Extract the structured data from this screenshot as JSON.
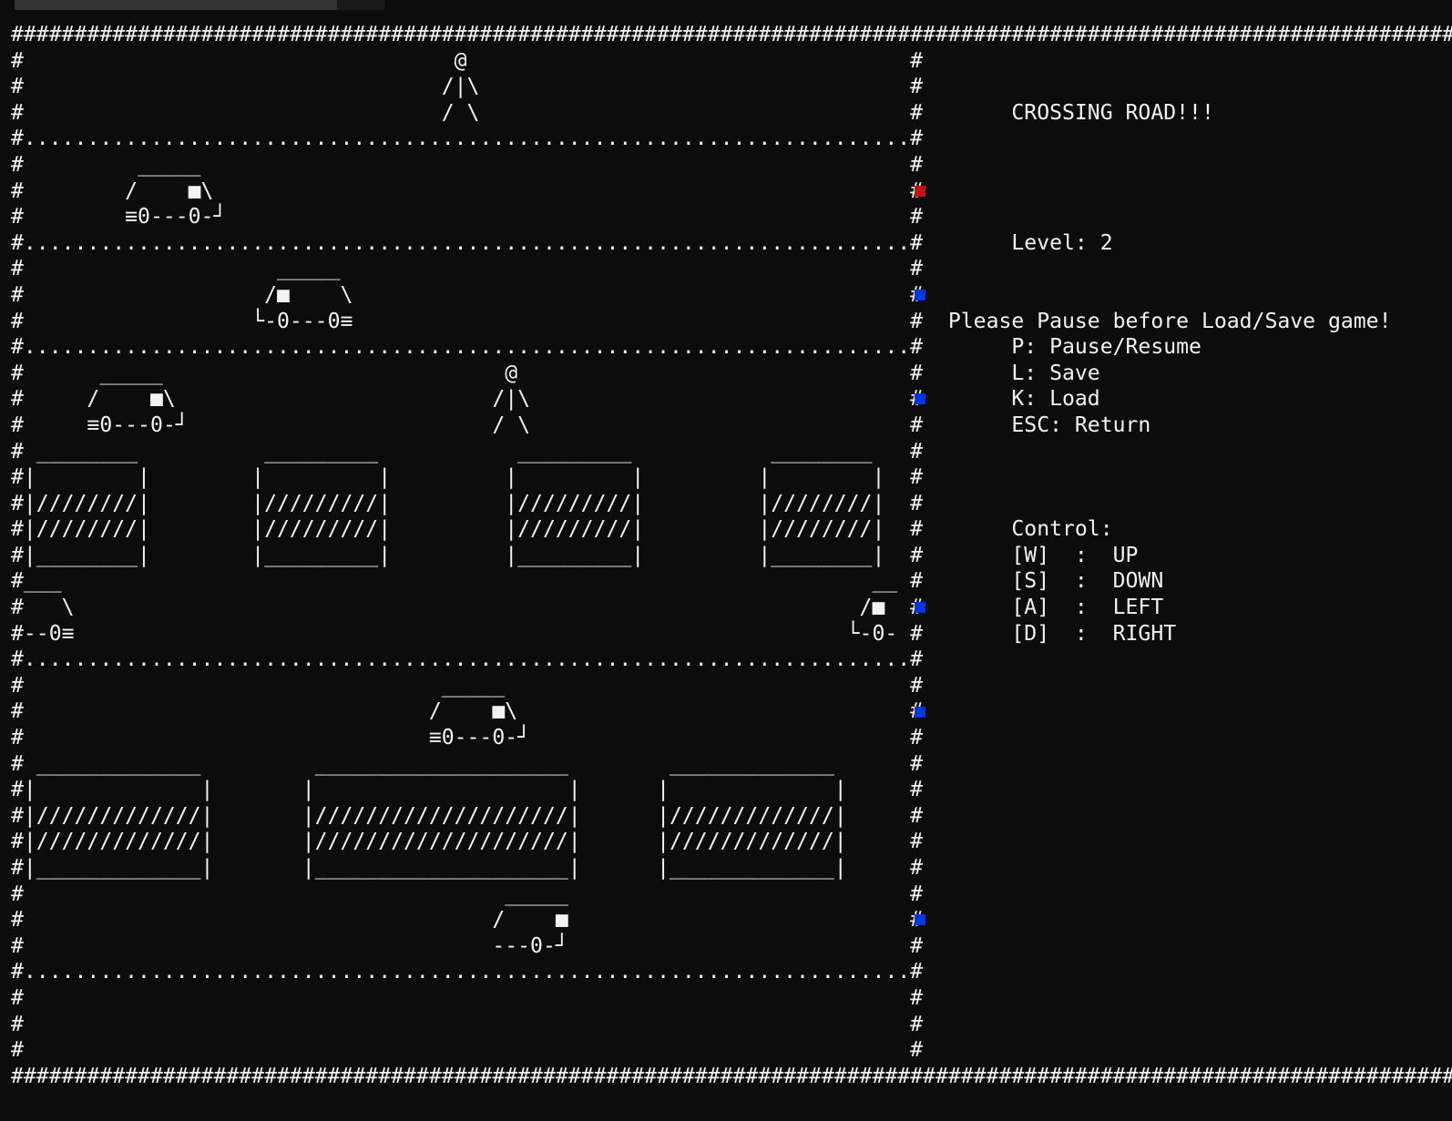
{
  "window": {
    "tab_color": "#333333"
  },
  "game": {
    "title": "CROSSING ROAD!!!",
    "level_label": "Level: 2",
    "save_warning": "Please Pause before Load/Save game!",
    "shortcuts": [
      "P: Pause/Resume",
      "L: Save",
      "K: Load",
      "ESC: Return"
    ],
    "controls_label": "Control:",
    "controls": [
      {
        "key": "[W]",
        "action": "UP"
      },
      {
        "key": "[S]",
        "action": "DOWN"
      },
      {
        "key": "[A]",
        "action": "LEFT"
      },
      {
        "key": "[D]",
        "action": "RIGHT"
      }
    ],
    "lane_markers": [
      {
        "color": "#c50f1f",
        "state": "red"
      },
      {
        "color": "#0037da",
        "state": "blue"
      },
      {
        "color": "#0037da",
        "state": "blue"
      },
      {
        "color": "#0037da",
        "state": "blue"
      },
      {
        "color": "#0037da",
        "state": "blue"
      },
      {
        "color": "#0037da",
        "state": "blue"
      }
    ],
    "screen_rows": [
      "####################################################################################################################",
      "#                                  @                                   #                                          #",
      "#                                 /|\\                                  #                                          #",
      "#                                 / \\                                  #       CROSSING ROAD!!!                   #",
      "#......................................................................#                                          #",
      "#         _____                                                        #                                          #",
      "#        /    ■\\                                                       #                                          #",
      "#        ≡0---0-┘                                                      #                                          #",
      "#......................................................................#       Level: 2                           #",
      "#                    _____                                             #                                          #",
      "#                   /■    \\                                            #                                          #",
      "#                  └-0---0≡                                            #  Please Pause before Load/Save game!     #",
      "#......................................................................#       P: Pause/Resume                    #",
      "#      _____                           @                               #       L: Save                            #",
      "#     /    ■\\                         /|\\                              #       K: Load                            #",
      "#     ≡0---0-┘                        / \\                              #       ESC: Return                        #",
      "# ________          _________           _________           ________   #                                          #",
      "#|        |        |         |         |         |         |        |  #                                          #",
      "#|////////|        |/////////|         |/////////|         |////////|  #                                          #",
      "#|////////|        |/////////|         |/////////|         |////////|  #       Control:                           #",
      "#|________|        |_________|         |_________|         |________|  #       [W]  :  UP                         #",
      "#___                                                                __ #       [S]  :  DOWN                       #",
      "#   \\                                                              /■  #       [A]  :  LEFT                       #",
      "#--0≡                                                             └-0- #       [D]  :  RIGHT                      #",
      "#......................................................................#                                          #",
      "#                                 _____                                #                                          #",
      "#                                /    ■\\                               #                                          #",
      "#                                ≡0---0-┘                              #                                          #",
      "# _____________         ____________________        _____________      #                                          #",
      "#|             |       |                    |      |             |     #                                          #",
      "#|/////////////|       |////////////////////|      |/////////////|     #                                          #",
      "#|/////////////|       |////////////////////|      |/////////////|     #                                          #",
      "#|_____________|       |____________________|      |_____________|     #                                          #",
      "#                                      _____                           #                                          #",
      "#                                     /    ■                           #                                          #",
      "#                                     ---0-┘                           #                                          #",
      "#......................................................................#                                          #",
      "#                                                                      #                                          #",
      "#                                                                      #                                          #",
      "#                                                                      #                                          #",
      "####################################################################################################################"
    ]
  }
}
